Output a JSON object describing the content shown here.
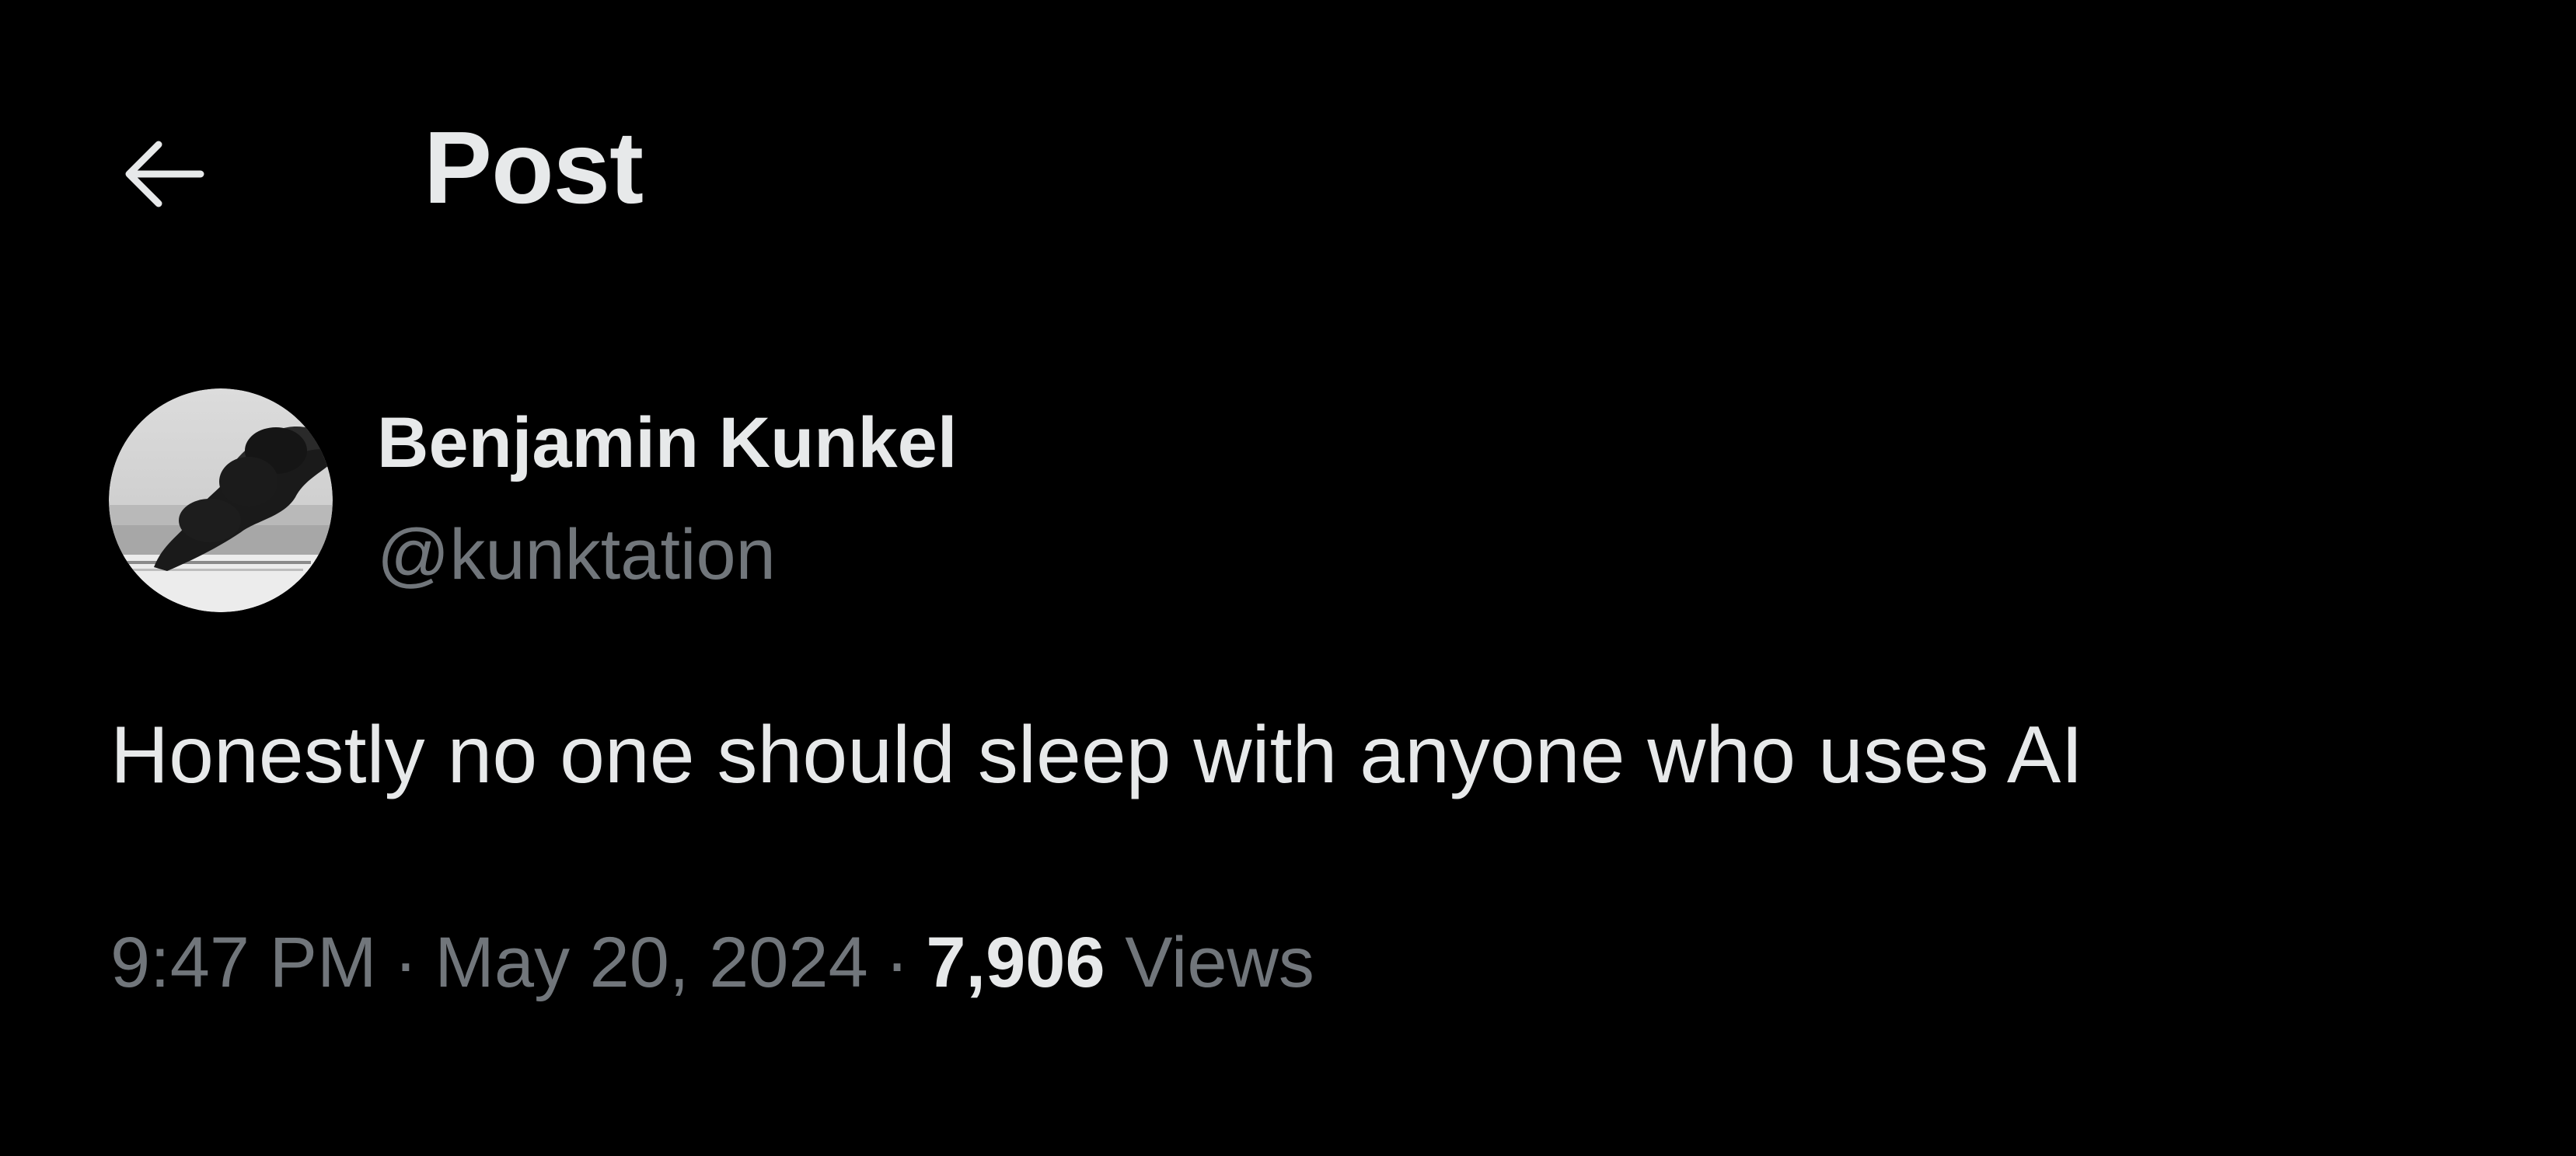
{
  "header": {
    "back_icon": "arrow-left-icon",
    "title": "Post"
  },
  "author": {
    "name": "Benjamin Kunkel",
    "handle": "@kunktation",
    "avatar_icon": "avatar-smoke-image"
  },
  "post": {
    "text": "Honestly no one should sleep with anyone who uses AI",
    "time": "9:47 PM",
    "separator": "·",
    "date": "May 20, 2024",
    "views_count": "7,906",
    "views_label": "Views"
  },
  "colors": {
    "background": "#000000",
    "primary_text": "#e7e9ea",
    "secondary_text": "#71767b"
  }
}
